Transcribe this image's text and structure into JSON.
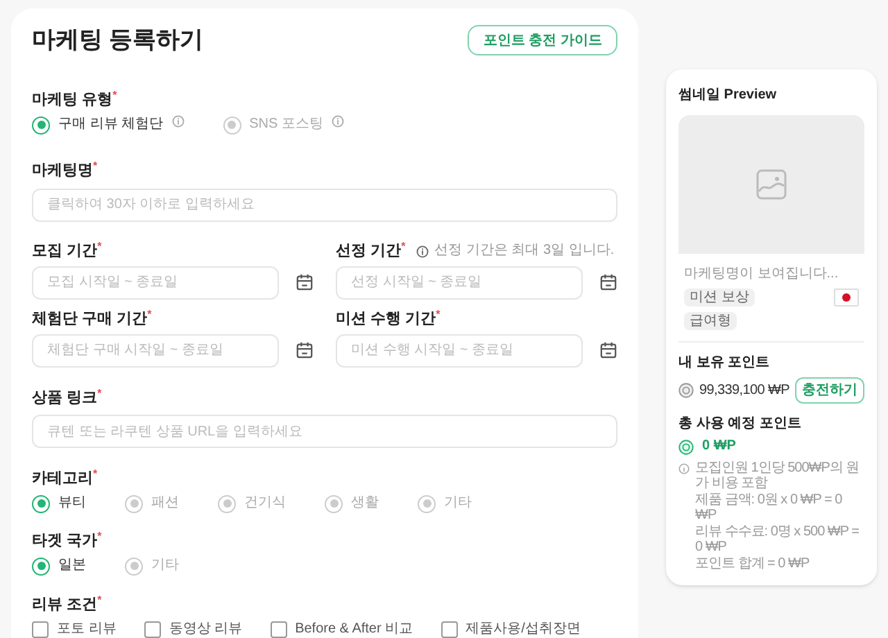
{
  "header": {
    "title": "마케팅 등록하기",
    "guide_button": "포인트 충전 가이드"
  },
  "fields": [
    {
      "kind": "radio",
      "label": "마케팅 유형$^{*}$",
      "options": [
        {
          "label": "구매 리뷰 체험단",
          "selected": true,
          "info": true
        },
        {
          "label": "SNS 포스팅",
          "selected": false,
          "info": true
        }
      ]
    },
    {
      "kind": "text",
      "label": "마케팅명$^{*}$",
      "placeholder": "클릭하여 30자 이하로 입력하세요"
    },
    {
      "kind": "date_pair",
      "items": [
        {
          "label": "모집 기간$^{*}$",
          "placeholder": "모집 시작일 ~ 종료일"
        },
        {
          "label": "선정 기간$^{*}$",
          "note": "선정 기간은 최대 3일 입니다.",
          "placeholder": "선정 시작일 ~ 종료일"
        }
      ]
    },
    {
      "kind": "date_pair",
      "items": [
        {
          "label": "체험단 구매 기간$^{*}$",
          "placeholder": "체험단 구매 시작일 ~ 종료일"
        },
        {
          "label": "미션 수행 기간$^{*}$",
          "placeholder": "미션 수행 시작일 ~ 종료일"
        }
      ]
    },
    {
      "kind": "text",
      "label": "상품 링크$^{*}$",
      "placeholder": "큐텐 또는 라쿠텐 상품 URL을 입력하세요"
    },
    {
      "kind": "radio",
      "label": "카테고리$^{*}$",
      "options": [
        {
          "label": "뷰티",
          "selected": true,
          "info": false
        },
        {
          "label": "패션",
          "selected": false,
          "info": false
        },
        {
          "label": "건기식",
          "selected": false,
          "info": false
        },
        {
          "label": "생활",
          "selected": false,
          "info": false
        },
        {
          "label": "기타",
          "selected": false,
          "info": false
        }
      ]
    },
    {
      "kind": "radio",
      "label": "타겟 국가$^{*}$",
      "options": [
        {
          "label": "일본",
          "selected": true,
          "info": false
        },
        {
          "label": "기타",
          "selected": false,
          "info": false
        }
      ]
    },
    {
      "kind": "checkbox",
      "label": "리뷰 조건$^{*}$",
      "options": [
        {
          "label": "포토 리뷰",
          "checked": false
        },
        {
          "label": "동영상 리뷰",
          "checked": false
        },
        {
          "label": "Before & After 비교",
          "checked": false
        },
        {
          "label": "제품사용/섭취장면",
          "checked": false
        }
      ]
    }
  ],
  "preview": {
    "title": "썸네일 Preview",
    "name": "마케팅명이 보여집니다...",
    "tags": [
      "미션 보상",
      "급여형"
    ]
  },
  "my_points": {
    "title": "내 보유 포인트",
    "amount": "99,339,100 ₩P",
    "button": "충전하기"
  },
  "total_points": {
    "title": "총 사용 예정 포인트",
    "amount": "0 ₩P",
    "notes": [
      "모집인원 1인당 500₩P의 원가 비용 포함",
      "제품 금액: 0원 x 0 ₩P = 0 ₩P",
      "리뷰 수수료: 0명 x 500 ₩P = 0 ₩P",
      "포인트 합계 = 0 ₩P"
    ]
  }
}
